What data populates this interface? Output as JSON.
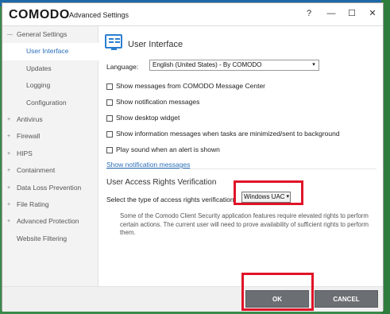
{
  "window": {
    "logo": "COMODO",
    "title": "Advanced Settings",
    "controls": {
      "help": "?",
      "minimize": "—",
      "maximize": "☐",
      "close": "✕"
    }
  },
  "sidebar": {
    "items": [
      {
        "label": "General Settings",
        "expander": "—"
      },
      {
        "label": "User Interface"
      },
      {
        "label": "Updates"
      },
      {
        "label": "Logging"
      },
      {
        "label": "Configuration"
      },
      {
        "label": "Antivirus",
        "expander": "+"
      },
      {
        "label": "Firewall",
        "expander": "+"
      },
      {
        "label": "HIPS",
        "expander": "+"
      },
      {
        "label": "Containment",
        "expander": "+"
      },
      {
        "label": "Data Loss Prevention",
        "expander": "+"
      },
      {
        "label": "File Rating",
        "expander": "+"
      },
      {
        "label": "Advanced Protection",
        "expander": "+"
      },
      {
        "label": "Website Filtering"
      }
    ]
  },
  "content": {
    "icon": "monitor-icon",
    "title": "User Interface",
    "language": {
      "label": "Language:",
      "value": "English (United States) - By COMODO",
      "dropdown_glyph": "▾"
    },
    "options": [
      {
        "label": "Show messages from COMODO Message Center",
        "checked": false
      },
      {
        "label": "Show notification messages",
        "checked": false
      },
      {
        "label": "Show desktop widget",
        "checked": false
      },
      {
        "label": "Show information messages when tasks are minimized/sent to background",
        "checked": false
      },
      {
        "label": "Play sound when an alert is shown",
        "checked": false
      }
    ],
    "notification_link": "Show notification messages",
    "uac": {
      "section_title": "User Access Rights Verification",
      "label": "Select the type of access rights verification:",
      "value": "Windows UAC",
      "dropdown_glyph": "▾",
      "note": "Some of the Comodo Client Security application features require elevated rights to perform certain actions. The current user will need to prove availability of sufficient rights to perform them."
    }
  },
  "footer": {
    "ok": "OK",
    "cancel": "CANCEL"
  },
  "colors": {
    "accent": "#2b6fb8",
    "highlight": "#e01428",
    "button": "#6b6f73"
  }
}
